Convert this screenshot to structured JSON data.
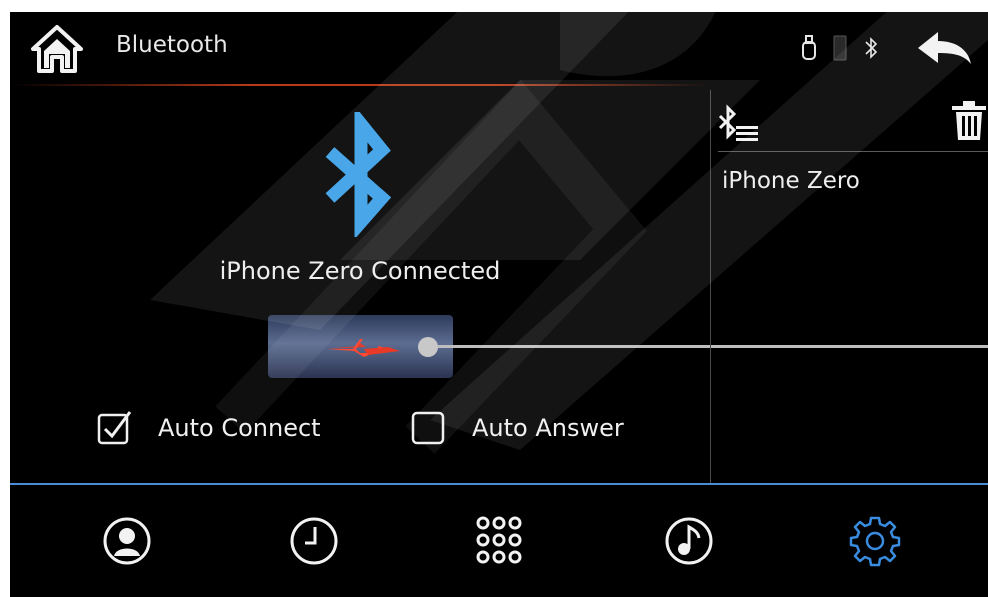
{
  "header": {
    "title": "Bluetooth",
    "icons": [
      "home-icon",
      "usb-icon",
      "phone-icon",
      "bluetooth-icon",
      "back-icon"
    ]
  },
  "connection": {
    "status_text": "iPhone Zero Connected",
    "icon": "bluetooth-icon",
    "accent": "#3aa0e8"
  },
  "options": {
    "auto_connect": {
      "label": "Auto Connect",
      "checked": true
    },
    "auto_answer": {
      "label": "Auto Answer",
      "checked": false
    }
  },
  "paired_list": {
    "items": [
      "iPhone Zero"
    ],
    "icons": [
      "bluetooth-list-icon",
      "trash-icon"
    ]
  },
  "bottom_tabs": [
    {
      "name": "contacts",
      "icon": "contact-icon"
    },
    {
      "name": "call-history",
      "icon": "clock-icon"
    },
    {
      "name": "dialpad",
      "icon": "dialpad-icon"
    },
    {
      "name": "music",
      "icon": "music-icon"
    },
    {
      "name": "settings",
      "icon": "gear-icon",
      "active": true
    }
  ],
  "colors": {
    "active_tab": "#3a8ce0",
    "divider": "#4a8bd6",
    "header_line": "#b83a1a"
  }
}
